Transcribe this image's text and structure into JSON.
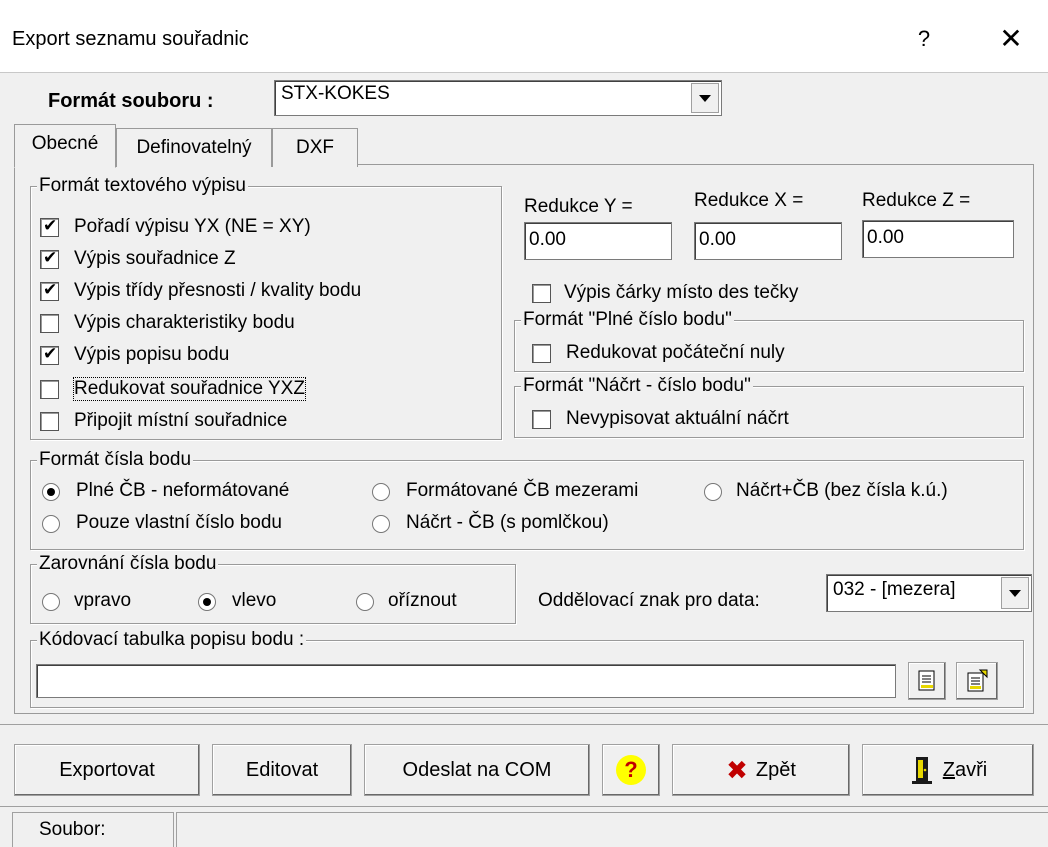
{
  "window": {
    "title": "Export seznamu souřadnic",
    "help": "?",
    "close": "✕"
  },
  "file_format": {
    "label": "Formát souboru :",
    "value": "STX-KOKES"
  },
  "tabs": [
    {
      "label": "Obecné"
    },
    {
      "label": "Definovatelný"
    },
    {
      "label": "DXF"
    }
  ],
  "text_output_group": {
    "title": "Formát textového výpisu",
    "options": [
      {
        "label": "Pořadí výpisu YX (NE = XY)",
        "checked": true
      },
      {
        "label": "Výpis souřadnice Z",
        "checked": true
      },
      {
        "label": "Výpis třídy přesnosti / kvality bodu",
        "checked": true
      },
      {
        "label": "Výpis charakteristiky bodu",
        "checked": false
      },
      {
        "label": "Výpis popisu bodu",
        "checked": true
      },
      {
        "label": "Redukovat souřadnice YXZ",
        "checked": false
      },
      {
        "label": "Připojit místní souřadnice",
        "checked": false
      }
    ]
  },
  "reductions": {
    "y_label": "Redukce Y =",
    "y_value": "0.00",
    "x_label": "Redukce X =",
    "x_value": "0.00",
    "z_label": "Redukce Z =",
    "z_value": "0.00"
  },
  "comma_option": {
    "label": "Výpis čárky místo des tečky",
    "checked": false
  },
  "full_number_group": {
    "title": "Formát \"Plné číslo bodu\"",
    "option": {
      "label": "Redukovat počáteční nuly",
      "checked": false
    }
  },
  "sketch_group": {
    "title": "Formát \"Náčrt - číslo bodu\"",
    "option": {
      "label": "Nevypisovat aktuální náčrt",
      "checked": false
    }
  },
  "point_number_group": {
    "title": "Formát čísla bodu",
    "options": [
      {
        "label": "Plné ČB - neformátované",
        "selected": true
      },
      {
        "label": "Formátované ČB mezerami",
        "selected": false
      },
      {
        "label": "Náčrt+ČB (bez čísla k.ú.)",
        "selected": false
      },
      {
        "label": "Pouze vlastní číslo bodu",
        "selected": false
      },
      {
        "label": "Náčrt - ČB (s pomlčkou)",
        "selected": false
      }
    ]
  },
  "alignment_group": {
    "title": "Zarovnání čísla bodu",
    "options": [
      {
        "label": "vpravo",
        "selected": false
      },
      {
        "label": "vlevo",
        "selected": true
      },
      {
        "label": "oříznout",
        "selected": false
      }
    ]
  },
  "separator": {
    "label": "Oddělovací znak pro data:",
    "value": "032 - [mezera]"
  },
  "encoding_group": {
    "title": "Kódovací tabulka popisu bodu :",
    "value": ""
  },
  "buttons": {
    "export": "Exportovat",
    "edit": "Editovat",
    "send_com": "Odeslat na COM",
    "help": "?",
    "back": "Zpět",
    "close": "Zavři",
    "close_mnemonic": "Z",
    "close_rest": "avři"
  },
  "status": {
    "file_label": "Soubor:"
  },
  "colors": {
    "accent_yellow": "#ffff00",
    "back_x": "#c00000",
    "window_bg": "#f0f0f0"
  }
}
